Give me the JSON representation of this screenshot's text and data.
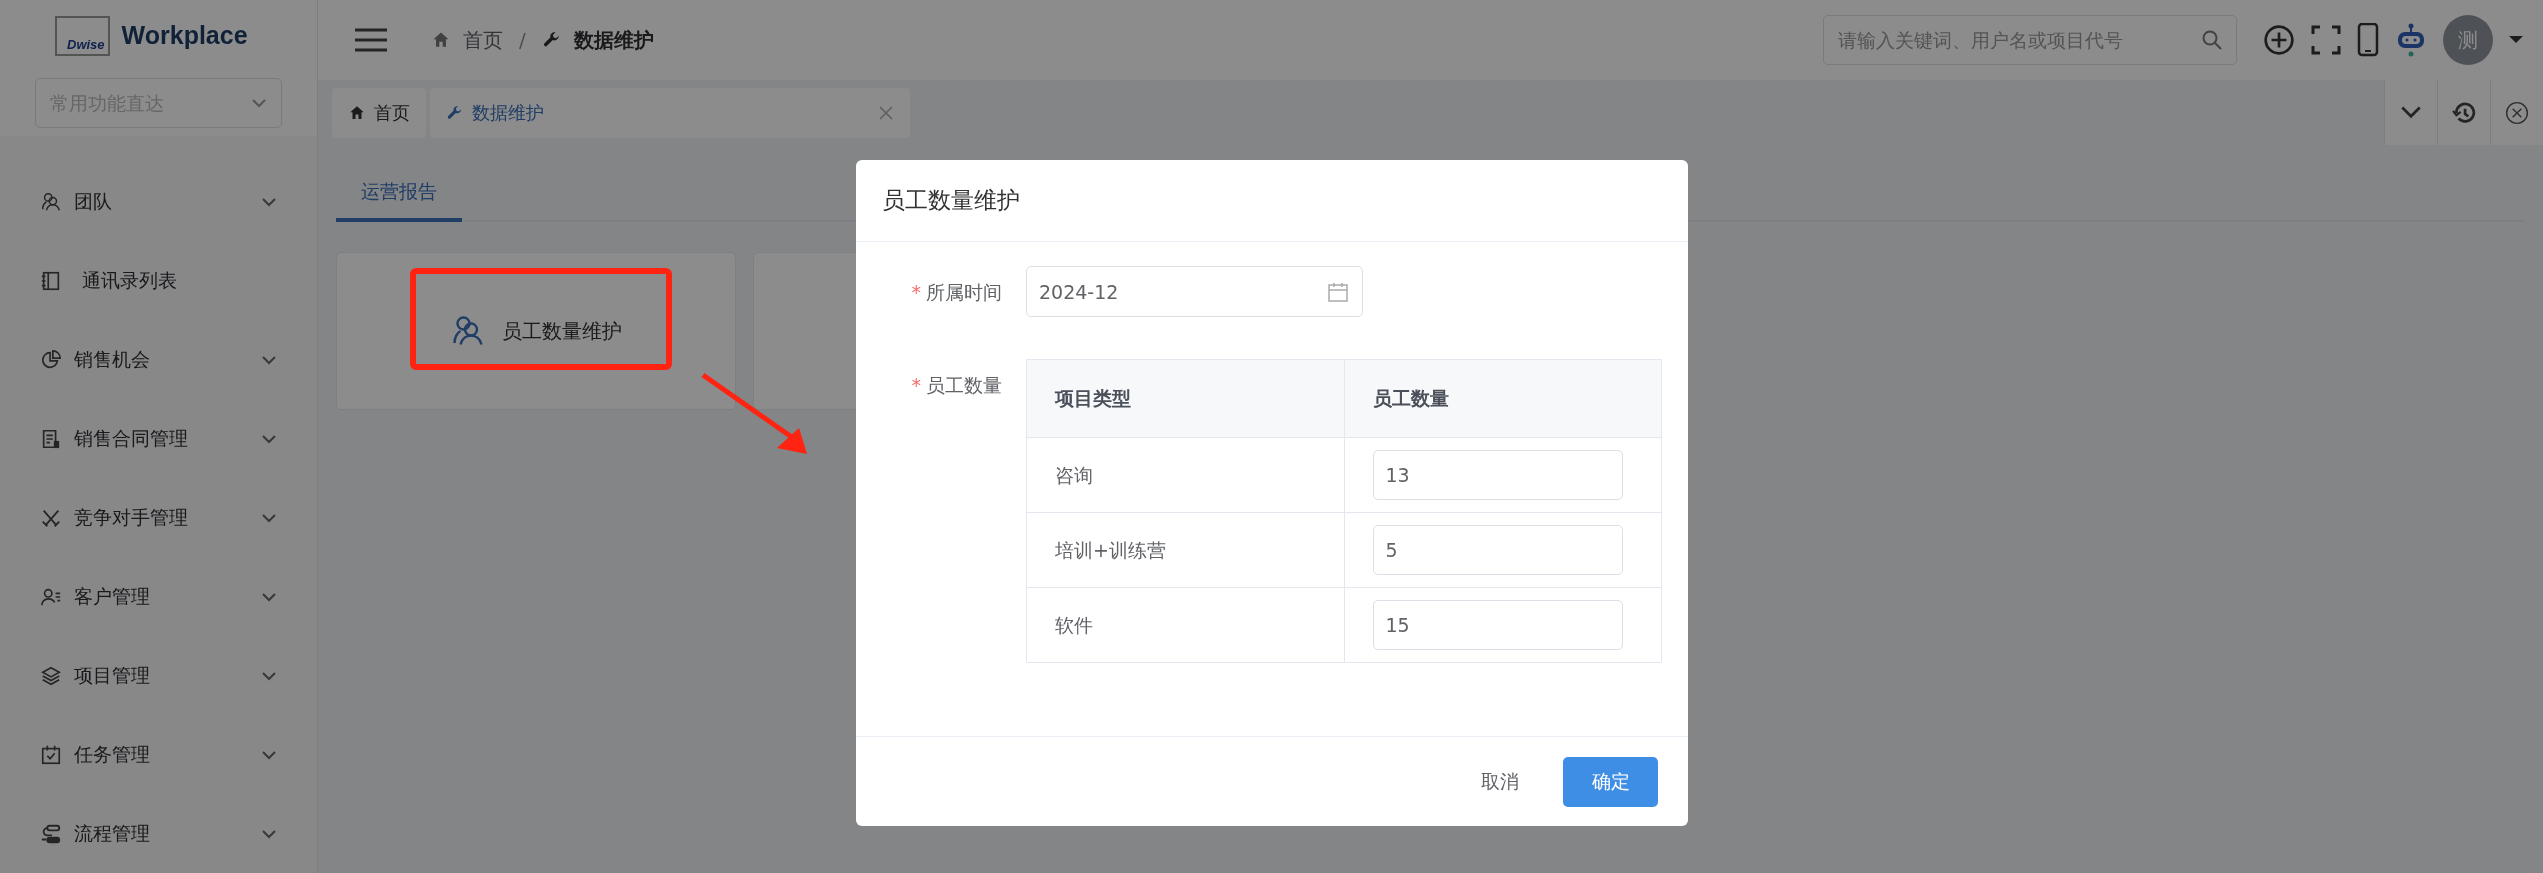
{
  "brand": {
    "mark": "Dwise",
    "name": "Workplace"
  },
  "quick_access": {
    "placeholder": "常用功能直达"
  },
  "breadcrumb": {
    "separator": "/",
    "items": [
      {
        "label": "首页"
      },
      {
        "label": "数据维护"
      }
    ]
  },
  "search": {
    "placeholder": "请输入关键词、用户名或项目代号"
  },
  "avatar": {
    "text": "测"
  },
  "page_tabs": [
    {
      "label": "首页",
      "selected": false,
      "closable": false
    },
    {
      "label": "数据维护",
      "selected": true,
      "closable": true
    }
  ],
  "sidebar": {
    "items": [
      {
        "label": "团队",
        "expandable": true
      },
      {
        "label": "通讯录列表",
        "expandable": false
      },
      {
        "label": "销售机会",
        "expandable": true
      },
      {
        "label": "销售合同管理",
        "expandable": true
      },
      {
        "label": "竞争对手管理",
        "expandable": true
      },
      {
        "label": "客户管理",
        "expandable": true
      },
      {
        "label": "项目管理",
        "expandable": true
      },
      {
        "label": "任务管理",
        "expandable": true
      },
      {
        "label": "流程管理",
        "expandable": true
      }
    ]
  },
  "content_tabs": [
    {
      "label": "运营报告",
      "selected": true
    }
  ],
  "cards": [
    {
      "label": "员工数量维护"
    }
  ],
  "annotations": {
    "highlight_frame": true,
    "arrow": true
  },
  "modal": {
    "title": "员工数量维护",
    "fields": [
      {
        "kind": "date",
        "required_mark": "*",
        "label": "所属时间",
        "value": "2024-12"
      },
      {
        "kind": "table",
        "required_mark": "*",
        "label": "员工数量",
        "columns": [
          "项目类型",
          "员工数量"
        ],
        "rows": [
          {
            "type": "咨询",
            "count": "13"
          },
          {
            "type": "培训+训练营",
            "count": "5"
          },
          {
            "type": "软件",
            "count": "15"
          }
        ]
      }
    ],
    "buttons": [
      {
        "label": "取消",
        "kind": "text"
      },
      {
        "label": "确定",
        "kind": "primary"
      }
    ]
  }
}
